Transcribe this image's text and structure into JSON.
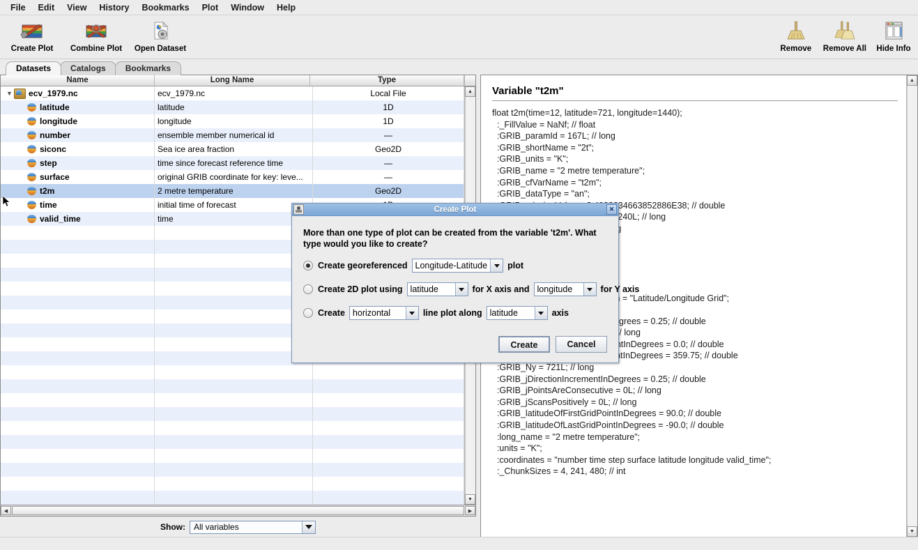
{
  "menubar": {
    "items": [
      {
        "label": "File"
      },
      {
        "label": "Edit"
      },
      {
        "label": "View"
      },
      {
        "label": "History"
      },
      {
        "label": "Bookmarks"
      },
      {
        "label": "Plot"
      },
      {
        "label": "Window"
      },
      {
        "label": "Help"
      }
    ]
  },
  "toolbar": {
    "left": [
      {
        "label": "Create Plot",
        "icon": "create-plot-icon"
      },
      {
        "label": "Combine Plot",
        "icon": "combine-plot-icon"
      },
      {
        "label": "Open Dataset",
        "icon": "open-dataset-icon"
      }
    ],
    "right": [
      {
        "label": "Remove",
        "icon": "broom-icon"
      },
      {
        "label": "Remove All",
        "icon": "double-broom-icon"
      },
      {
        "label": "Hide Info",
        "icon": "hide-info-icon"
      }
    ]
  },
  "tabs": [
    {
      "label": "Datasets",
      "active": true
    },
    {
      "label": "Catalogs",
      "active": false
    },
    {
      "label": "Bookmarks",
      "active": false
    }
  ],
  "table": {
    "columns": [
      "Name",
      "Long Name",
      "Type"
    ],
    "rows": [
      {
        "name": "ecv_1979.nc",
        "long_name": "ecv_1979.nc",
        "type": "Local File",
        "kind": "file",
        "expanded": true,
        "selected": false
      },
      {
        "name": "latitude",
        "long_name": "latitude",
        "type": "1D",
        "kind": "var",
        "selected": false
      },
      {
        "name": "longitude",
        "long_name": "longitude",
        "type": "1D",
        "kind": "var",
        "selected": false
      },
      {
        "name": "number",
        "long_name": "ensemble member numerical id",
        "type": "—",
        "kind": "var",
        "selected": false
      },
      {
        "name": "siconc",
        "long_name": "Sea ice area fraction",
        "type": "Geo2D",
        "kind": "var",
        "selected": false
      },
      {
        "name": "step",
        "long_name": "time since forecast reference time",
        "type": "—",
        "kind": "var",
        "selected": false
      },
      {
        "name": "surface",
        "long_name": "original GRIB coordinate for key: leve...",
        "type": "—",
        "kind": "var",
        "selected": false
      },
      {
        "name": "t2m",
        "long_name": "2 metre temperature",
        "type": "Geo2D",
        "kind": "var",
        "selected": true
      },
      {
        "name": "time",
        "long_name": "initial time of forecast",
        "type": "1D",
        "kind": "var",
        "selected": false
      },
      {
        "name": "valid_time",
        "long_name": "time",
        "type": "",
        "kind": "var",
        "selected": false
      }
    ]
  },
  "show_bar": {
    "label": "Show:",
    "selected": "All variables"
  },
  "info_panel": {
    "title": "Variable \"t2m\"",
    "body": "float t2m(time=12, latitude=721, longitude=1440);\n  :_FillValue = NaNf; // float\n  :GRIB_paramId = 167L; // long\n  :GRIB_shortName = \"2t\";\n  :GRIB_units = \"K\";\n  :GRIB_name = \"2 metre temperature\";\n  :GRIB_cfVarName = \"t2m\";\n  :GRIB_dataType = \"an\";\n  :GRIB_missingValue = 3.4028234663852886E38; // double\n  :GRIB_numberOfPoints = 1038240L; // long\n  :GRIB_totalNumber = 0L; // long\n  :GRIB_typeOfLevel = \"surface\";\n  :GRIB_NV = 0L; // long\n  :GRIB_stepUnits = 1L; // long\n  :GRIB_stepType = \"instant\";\n  :GRIB_gridType = \"regular_ll\";\n  :GRIB_gridDefinitionDescription = \"Latitude/Longitude Grid\";\n  :GRIB_Nx = 1440L; // long\n  :GRIB_iDirectionIncrementInDegrees = 0.25; // double\n  :GRIB_iScansNegatively = 0L; // long\n  :GRIB_longitudeOfFirstGridPointInDegrees = 0.0; // double\n  :GRIB_longitudeOfLastGridPointInDegrees = 359.75; // double\n  :GRIB_Ny = 721L; // long\n  :GRIB_jDirectionIncrementInDegrees = 0.25; // double\n  :GRIB_jPointsAreConsecutive = 0L; // long\n  :GRIB_jScansPositively = 0L; // long\n  :GRIB_latitudeOfFirstGridPointInDegrees = 90.0; // double\n  :GRIB_latitudeOfLastGridPointInDegrees = -90.0; // double\n  :long_name = \"2 metre temperature\";\n  :units = \"K\";\n  :coordinates = \"number time step surface latitude longitude valid_time\";\n  :_ChunkSizes = 4, 241, 480; // int"
  },
  "dialog": {
    "title": "Create Plot",
    "close_label": "✕",
    "question": "More than one type of plot can be created from the variable\n't2m'. What type would you like to create?",
    "option1": {
      "selected": true,
      "text_before": "Create georeferenced",
      "combo_value": "Longitude-Latitude",
      "text_after": "plot"
    },
    "option2": {
      "selected": false,
      "text_before": "Create 2D plot using",
      "combo_x": "latitude",
      "text_mid": "for X axis and",
      "combo_y": "longitude",
      "text_after": "for Y axis"
    },
    "option3": {
      "selected": false,
      "text_before": "Create",
      "combo_orient": "horizontal",
      "text_mid": "line plot along",
      "combo_axis": "latitude",
      "text_after": "axis"
    },
    "create_label": "Create",
    "cancel_label": "Cancel"
  },
  "colors": {
    "accent": "#7aa6d6",
    "selection": "#bdd2ee",
    "row_alt": "#eaf0fb",
    "window_bg": "#ececec"
  }
}
